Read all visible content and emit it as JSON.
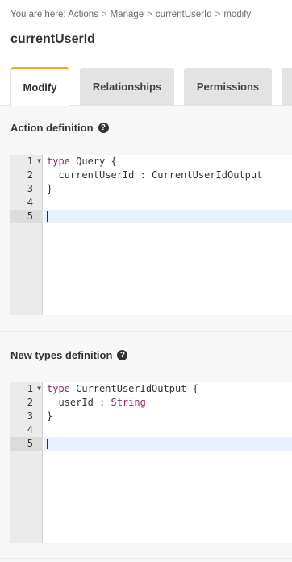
{
  "breadcrumb": {
    "prefix": "You are here:",
    "items": [
      "Actions",
      "Manage",
      "currentUserId",
      "modify"
    ],
    "separator": ">"
  },
  "page_title": "currentUserId",
  "tabs": [
    {
      "label": "Modify",
      "active": true
    },
    {
      "label": "Relationships",
      "active": false
    },
    {
      "label": "Permissions",
      "active": false
    }
  ],
  "action_definition": {
    "heading": "Action definition",
    "lines": [
      {
        "n": "1",
        "kw": "type",
        "rest": " Query {",
        "fold": true
      },
      {
        "n": "2",
        "text": "  currentUserId : CurrentUserIdOutput"
      },
      {
        "n": "3",
        "text": "}"
      },
      {
        "n": "4",
        "text": ""
      },
      {
        "n": "5",
        "text": "",
        "active": true
      }
    ]
  },
  "types_definition": {
    "heading": "New types definition",
    "lines": [
      {
        "n": "1",
        "kw": "type",
        "rest": " CurrentUserIdOutput {",
        "fold": true
      },
      {
        "n": "2",
        "prefix": "  userId : ",
        "type": "String"
      },
      {
        "n": "3",
        "text": "}"
      },
      {
        "n": "4",
        "text": ""
      },
      {
        "n": "5",
        "text": "",
        "active": true
      }
    ]
  },
  "colors": {
    "accent_tab_border": "#f5a623",
    "keyword": "#93227c",
    "active_line": "#e8f2fe"
  }
}
